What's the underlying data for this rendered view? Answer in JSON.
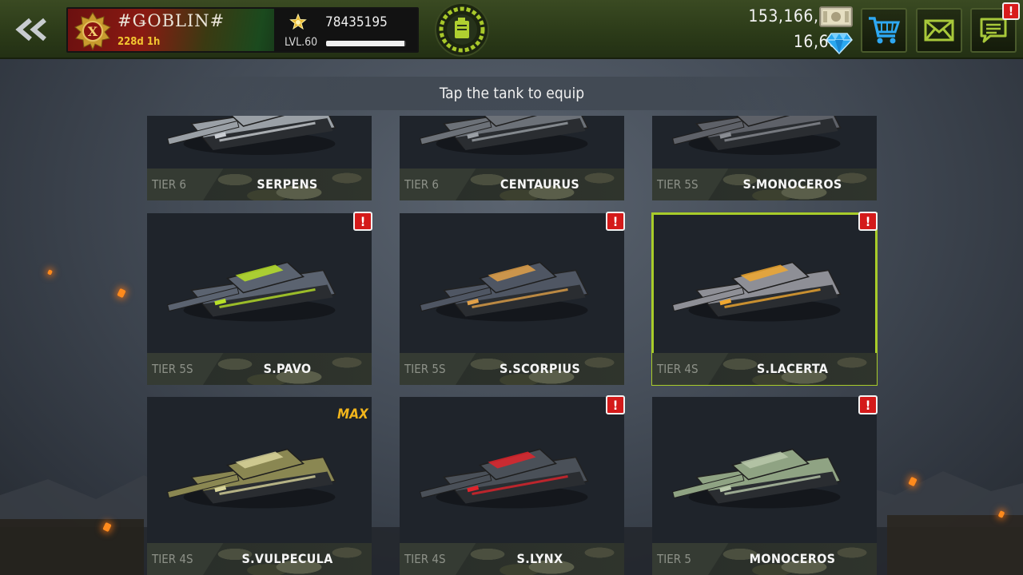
{
  "header": {
    "player_name": "#ǤOBLIN#",
    "play_time": "228d 1h",
    "rank_letter": "X",
    "xp": "78435195",
    "level": "LVL.60",
    "level_progress": 0.98,
    "money": "153,166,584",
    "gems": "16,684",
    "chat_alert": "!"
  },
  "page": {
    "title": "Tap the tank to equip"
  },
  "tanks": [
    {
      "tier": "TIER 6",
      "name": "SERPENS",
      "alert": "",
      "max": "",
      "selected": false,
      "color": "#9aa0a6",
      "accent": "#c9cdd2"
    },
    {
      "tier": "TIER 6",
      "name": "CENTAURUS",
      "alert": "",
      "max": "",
      "selected": false,
      "color": "#6c7178",
      "accent": "#9ba0a6"
    },
    {
      "tier": "TIER 5S",
      "name": "S.MONOCEROS",
      "alert": "",
      "max": "",
      "selected": false,
      "color": "#5e6168",
      "accent": "#8a8d93"
    },
    {
      "tier": "TIER 5S",
      "name": "S.PAVO",
      "alert": "!",
      "max": "",
      "selected": false,
      "color": "#5b6370",
      "accent": "#b8e028"
    },
    {
      "tier": "TIER 5S",
      "name": "S.SCORPIUS",
      "alert": "!",
      "max": "",
      "selected": false,
      "color": "#4f5663",
      "accent": "#e0a048"
    },
    {
      "tier": "TIER 4S",
      "name": "S.LACERTA",
      "alert": "!",
      "max": "",
      "selected": true,
      "color": "#8e8f96",
      "accent": "#f0a830"
    },
    {
      "tier": "TIER 4S",
      "name": "S.VULPECULA",
      "alert": "",
      "max": "MAX",
      "selected": false,
      "color": "#8a8752",
      "accent": "#d8d49a"
    },
    {
      "tier": "TIER 4S",
      "name": "S.LYNX",
      "alert": "!",
      "max": "",
      "selected": false,
      "color": "#4a5058",
      "accent": "#e0242c"
    },
    {
      "tier": "TIER 5",
      "name": "MONOCEROS",
      "alert": "!",
      "max": "",
      "selected": false,
      "color": "#8fa383",
      "accent": "#b8c8aa"
    }
  ],
  "icons": {
    "back": "double-chevron-left-icon",
    "fuel": "fuel-can-icon",
    "shop": "shopping-cart-icon",
    "mail": "envelope-icon",
    "chat": "chat-icon",
    "money": "cash-icon",
    "gem": "diamond-icon"
  }
}
